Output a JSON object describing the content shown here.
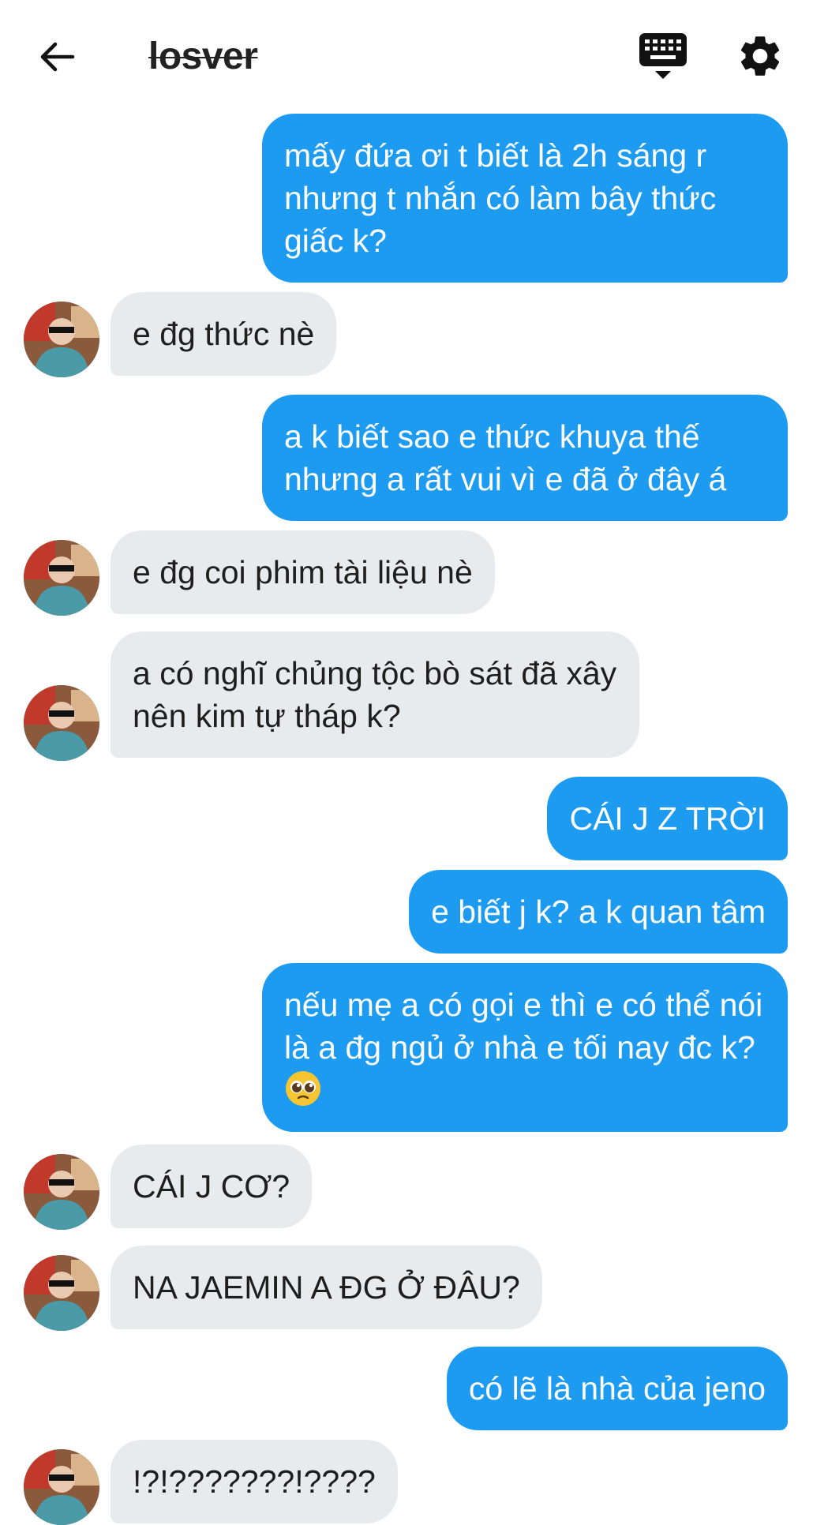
{
  "header": {
    "title": "losver",
    "back_icon": "arrow-left-icon",
    "keyboard_icon": "keyboard-icon",
    "settings_icon": "gear-icon"
  },
  "colors": {
    "outgoing_bubble": "#1d9bf0",
    "incoming_bubble": "#e8ebee"
  },
  "messages": [
    {
      "direction": "out",
      "text": "mấy đứa ơi t biết là 2h sáng r nhưng t nhắn có làm bây thức giấc k?"
    },
    {
      "direction": "in",
      "text": "e đg thức nè"
    },
    {
      "direction": "out",
      "text": "a k biết sao e thức khuya thế nhưng a rất vui vì e đã ở đây á"
    },
    {
      "direction": "in",
      "text": "e đg coi phim tài liệu nè"
    },
    {
      "direction": "in",
      "text": "a có nghĩ chủng tộc bò sát đã xây nên kim tự tháp k?"
    },
    {
      "direction": "out",
      "text": "CÁI J Z TRỜI"
    },
    {
      "direction": "out",
      "text": "e biết j k? a k quan tâm"
    },
    {
      "direction": "out",
      "text": "nếu mẹ a có gọi e thì e có thể nói là a đg ngủ ở nhà e tối nay đc k?",
      "emoji": "pleading-face-emoji"
    },
    {
      "direction": "in",
      "text": "CÁI J CƠ?"
    },
    {
      "direction": "in",
      "text": "NA JAEMIN A ĐG Ở ĐÂU?"
    },
    {
      "direction": "out",
      "text": "có lẽ là nhà của jeno"
    },
    {
      "direction": "in",
      "text": "!?!???????!????"
    }
  ]
}
